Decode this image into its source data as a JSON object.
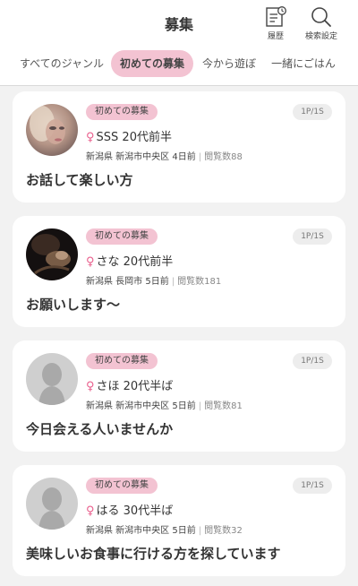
{
  "header": {
    "title": "募集",
    "history_label": "履歴",
    "search_settings_label": "検索設定"
  },
  "tabs": [
    {
      "label": "すべてのジャンル"
    },
    {
      "label": "初めての募集"
    },
    {
      "label": "今から遊ぼ"
    },
    {
      "label": "一緒にごはん"
    }
  ],
  "active_tab": "初めての募集",
  "colors": {
    "accent_pink": "#f3c3d2",
    "female_symbol": "#e95e8c",
    "background": "#f2f2f2"
  },
  "posts": [
    {
      "genre": "初めての募集",
      "page": "1P/1S",
      "gender_symbol": "♀",
      "name_age": "SSS 20代前半",
      "location": "新潟県 新潟市中央区",
      "posted": "4日前",
      "views": "閲覧数88",
      "message": "お話して楽しい方",
      "avatar": "photo-blonde"
    },
    {
      "genre": "初めての募集",
      "page": "1P/1S",
      "gender_symbol": "♀",
      "name_age": "さな 20代前半",
      "location": "新潟県 長岡市",
      "posted": "5日前",
      "views": "閲覧数181",
      "message": "お願いします〜",
      "avatar": "photo-dark"
    },
    {
      "genre": "初めての募集",
      "page": "1P/1S",
      "gender_symbol": "♀",
      "name_age": "さほ 20代半ば",
      "location": "新潟県 新潟市中央区",
      "posted": "5日前",
      "views": "閲覧数81",
      "message": "今日会える人いませんか",
      "avatar": "default-silhouette"
    },
    {
      "genre": "初めての募集",
      "page": "1P/1S",
      "gender_symbol": "♀",
      "name_age": "はる 30代半ば",
      "location": "新潟県 新潟市中央区",
      "posted": "5日前",
      "views": "閲覧数32",
      "message": "美味しいお食事に行ける方を探しています",
      "avatar": "default-silhouette"
    }
  ]
}
